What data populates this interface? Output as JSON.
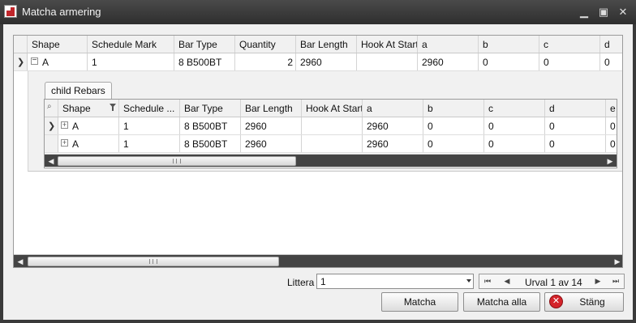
{
  "window": {
    "title": "Matcha armering"
  },
  "grid": {
    "columns": [
      "Shape",
      "Schedule Mark",
      "Bar Type",
      "Quantity",
      "Bar Length",
      "Hook At Start",
      "a",
      "b",
      "c",
      "d"
    ],
    "row": [
      "A",
      "1",
      "8 B500BT",
      "2",
      "2960",
      "",
      "2960",
      "0",
      "0",
      "0"
    ]
  },
  "child": {
    "tab_label": "child Rebars",
    "columns": [
      "Shape",
      "Schedule ...",
      "Bar Type",
      "Bar Length",
      "Hook At Start",
      "a",
      "b",
      "c",
      "d",
      "e"
    ],
    "rows": [
      [
        "A",
        "1",
        "8 B500BT",
        "2960",
        "",
        "2960",
        "0",
        "0",
        "0",
        "0"
      ],
      [
        "A",
        "1",
        "8 B500BT",
        "2960",
        "",
        "2960",
        "0",
        "0",
        "0",
        "0"
      ]
    ]
  },
  "footer": {
    "littera_label": "Littera",
    "littera_value": "1",
    "nav_text": "Urval 1 av 14",
    "matcha_label": "Matcha",
    "matcha_alla_label": "Matcha alla",
    "stang_label": "Stäng"
  },
  "icons": [
    "app-icon",
    "minimize-icon",
    "maximize-icon",
    "close-icon",
    "search-icon",
    "filter-icon",
    "expand-icon",
    "collapse-icon",
    "stop-icon"
  ]
}
